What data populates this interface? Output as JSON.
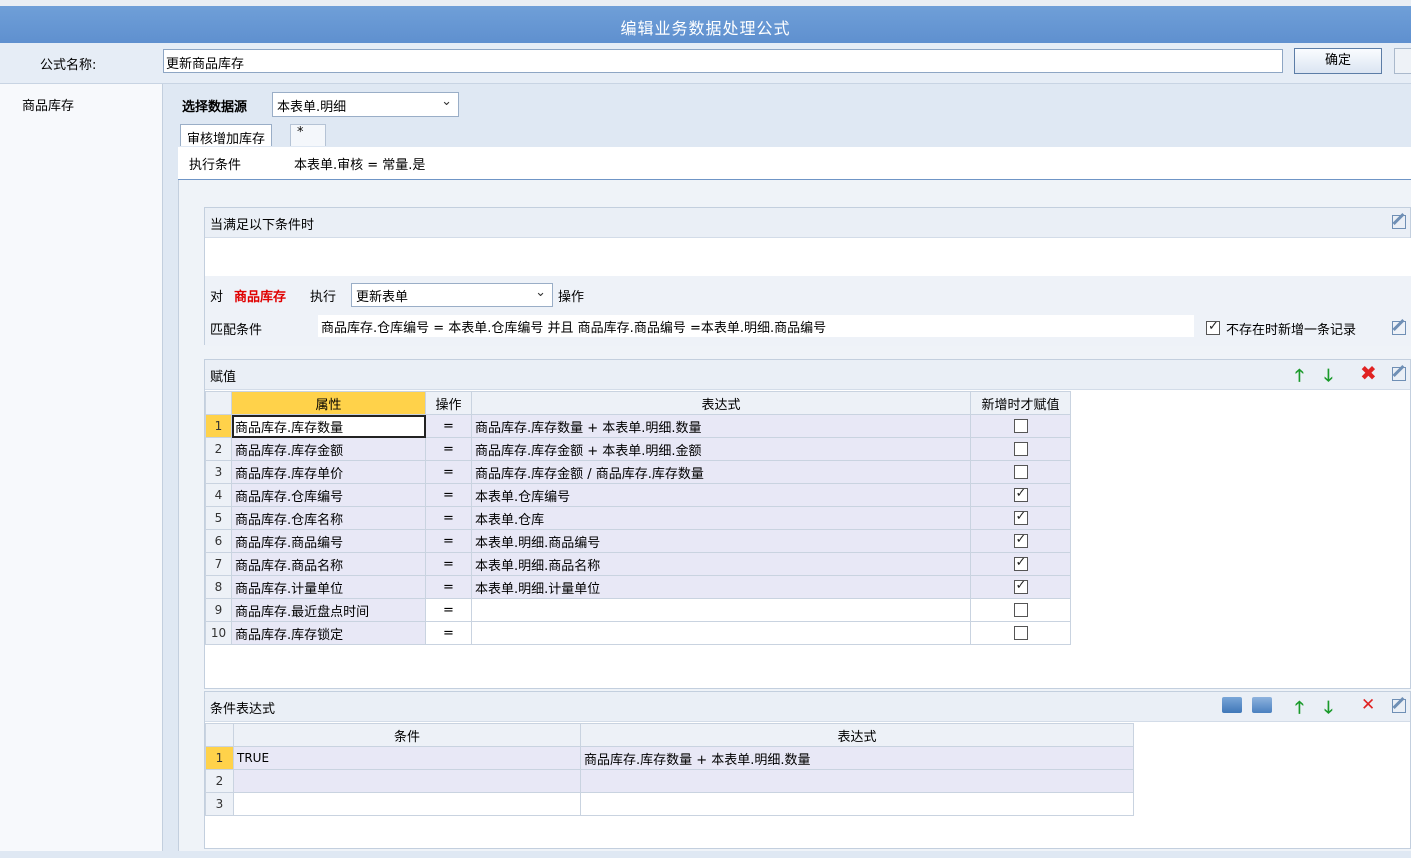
{
  "window": {
    "title": "编辑业务数据处理公式"
  },
  "formula": {
    "name_label": "公式名称:",
    "name_value": "更新商品库存",
    "ok_label": "确定"
  },
  "sidebar": {
    "items": [
      {
        "label": "商品库存"
      }
    ]
  },
  "source": {
    "label": "选择数据源",
    "selected": "本表单.明细"
  },
  "tabs": [
    {
      "label": "审核增加库存"
    },
    {
      "label": "*"
    }
  ],
  "exec": {
    "label": "执行条件",
    "value": "本表单.审核 = 常量.是"
  },
  "when": {
    "title": "当满足以下条件时"
  },
  "action": {
    "prefix": "对",
    "target": "商品库存",
    "mid": "执行",
    "operation": "更新表单",
    "suffix": "操作",
    "match_label": "匹配条件",
    "match_value": "商品库存.仓库编号 = 本表单.仓库编号 并且 商品库存.商品编号 =本表单.明细.商品编号",
    "new_record_label": "不存在时新增一条记录",
    "new_record_checked": true
  },
  "assign": {
    "title": "赋值",
    "columns": [
      "属性",
      "操作",
      "表达式",
      "新增时才赋值"
    ],
    "rows": [
      {
        "no": "1",
        "attr": "商品库存.库存数量",
        "op": "=",
        "expr": "商品库存.库存数量 + 本表单.明细.数量",
        "only_new": false
      },
      {
        "no": "2",
        "attr": "商品库存.库存金额",
        "op": "=",
        "expr": "商品库存.库存金额 + 本表单.明细.金额",
        "only_new": false
      },
      {
        "no": "3",
        "attr": "商品库存.库存单价",
        "op": "=",
        "expr": "商品库存.库存金额 / 商品库存.库存数量",
        "only_new": false
      },
      {
        "no": "4",
        "attr": "商品库存.仓库编号",
        "op": "=",
        "expr": "本表单.仓库编号",
        "only_new": true
      },
      {
        "no": "5",
        "attr": "商品库存.仓库名称",
        "op": "=",
        "expr": "本表单.仓库",
        "only_new": true
      },
      {
        "no": "6",
        "attr": "商品库存.商品编号",
        "op": "=",
        "expr": "本表单.明细.商品编号",
        "only_new": true
      },
      {
        "no": "7",
        "attr": "商品库存.商品名称",
        "op": "=",
        "expr": "本表单.明细.商品名称",
        "only_new": true
      },
      {
        "no": "8",
        "attr": "商品库存.计量单位",
        "op": "=",
        "expr": "本表单.明细.计量单位",
        "only_new": true
      },
      {
        "no": "9",
        "attr": "商品库存.最近盘点时间",
        "op": "=",
        "expr": "",
        "only_new": false
      },
      {
        "no": "10",
        "attr": "商品库存.库存锁定",
        "op": "=",
        "expr": "",
        "only_new": false
      }
    ]
  },
  "cond_expr": {
    "title": "条件表达式",
    "columns": [
      "条件",
      "表达式"
    ],
    "rows": [
      {
        "no": "1",
        "cond": "TRUE",
        "expr": "商品库存.库存数量 + 本表单.明细.数量"
      },
      {
        "no": "2",
        "cond": "",
        "expr": ""
      },
      {
        "no": "3",
        "cond": "",
        "expr": ""
      }
    ]
  },
  "colors": {
    "titlebar": "#5f90cf",
    "highlight_header": "#ffd24a",
    "row_band": "#e8e8f6",
    "accent_red": "#e00000",
    "arrow_green": "#1a9a2a"
  }
}
